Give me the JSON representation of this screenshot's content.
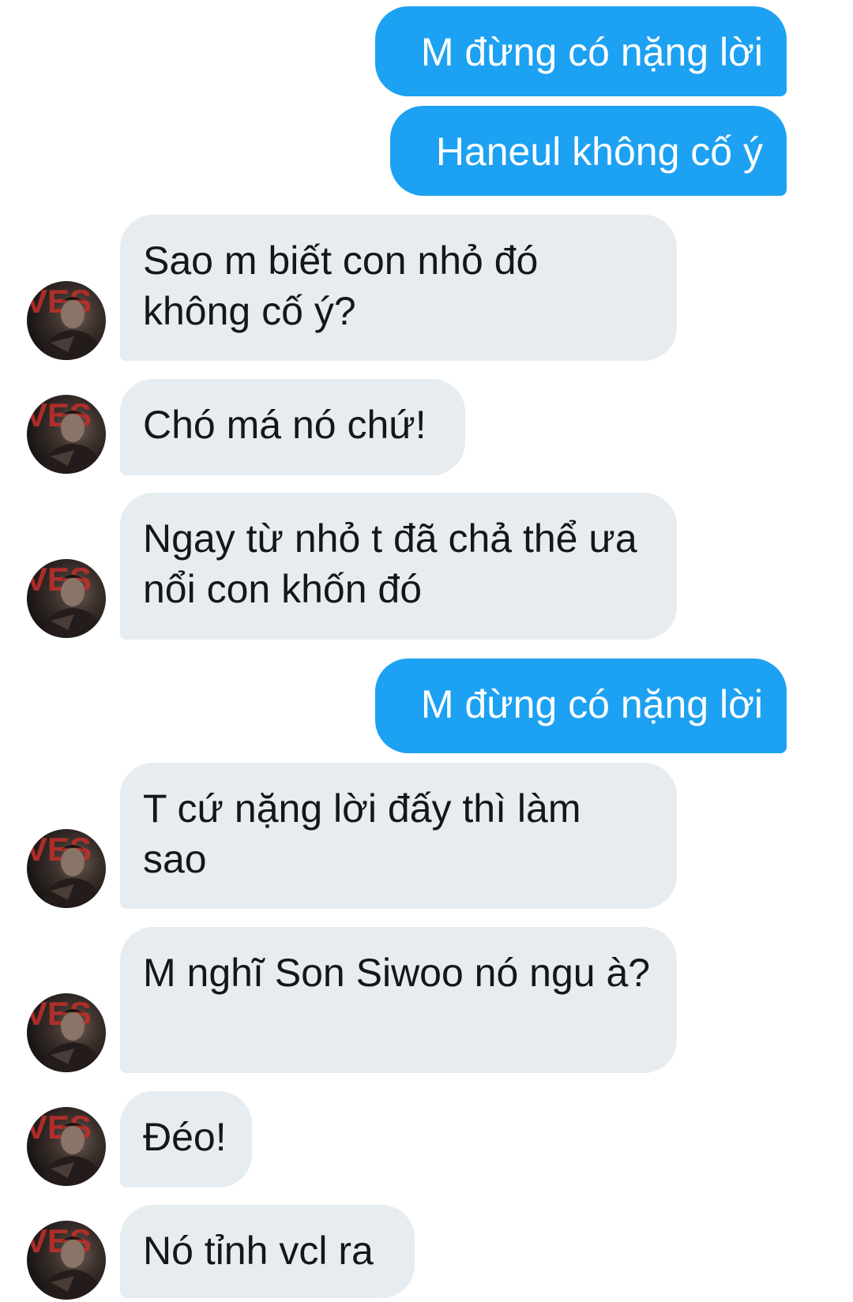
{
  "messages": [
    {
      "id": "m1",
      "side": "sent",
      "text": "M đừng có nặng lời"
    },
    {
      "id": "m2",
      "side": "sent",
      "text": "Haneul không cố ý"
    },
    {
      "id": "m3",
      "side": "received",
      "text": "Sao m biết con nhỏ đó không cố ý?"
    },
    {
      "id": "m4",
      "side": "received",
      "text": "Chó má nó chứ!"
    },
    {
      "id": "m5",
      "side": "received",
      "text": "Ngay từ nhỏ t đã chả thể ưa nổi con khốn đó"
    },
    {
      "id": "m6",
      "side": "sent",
      "text": "M đừng có nặng lời"
    },
    {
      "id": "m7",
      "side": "received",
      "text": "T cứ nặng lời đấy thì làm sao"
    },
    {
      "id": "m8",
      "side": "received",
      "text": "M nghĩ Son Siwoo nó ngu à?"
    },
    {
      "id": "m9",
      "side": "received",
      "text": "Đéo!"
    },
    {
      "id": "m10",
      "side": "received",
      "text": "Nó tỉnh vcl ra"
    }
  ],
  "avatar": {
    "icon": "user-avatar-icon",
    "letters": "VES"
  },
  "colors": {
    "sent_bubble": "#1da1f2",
    "sent_text": "#ffffff",
    "received_bubble": "#e6ecf0",
    "received_text": "#14171a",
    "background": "#ffffff"
  }
}
